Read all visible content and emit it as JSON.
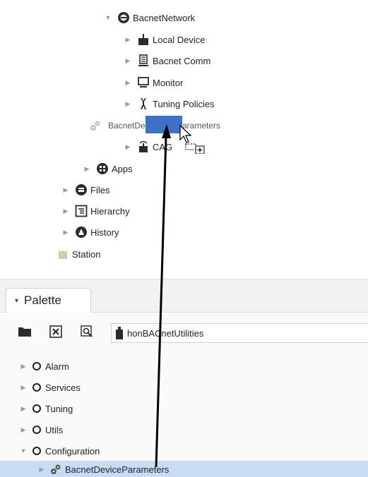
{
  "tree": {
    "items": [
      {
        "label": "BacnetNetwork",
        "icon": "network-globe-icon"
      },
      {
        "label": "Local Device",
        "icon": "device-icon"
      },
      {
        "label": "Bacnet Comm",
        "icon": "comm-stack-icon"
      },
      {
        "label": "Monitor",
        "icon": "monitor-icon"
      },
      {
        "label": "Tuning Policies",
        "icon": "tuning-tool-icon"
      },
      {
        "label": "BacnetDeviceParameters",
        "icon": "gears-icon"
      },
      {
        "label": "CAG",
        "icon": "device-antenna-icon"
      },
      {
        "label": "Apps",
        "icon": "apps-icon"
      },
      {
        "label": "Files",
        "icon": "files-icon"
      },
      {
        "label": "Hierarchy",
        "icon": "hierarchy-icon"
      },
      {
        "label": "History",
        "icon": "history-icon"
      },
      {
        "label": "Station",
        "icon": "station-icon"
      }
    ],
    "drag_overlay_text": "BacnetDe",
    "drag_overlay_text2": "arameters"
  },
  "palette": {
    "title": "Palette",
    "module": "honBACnetUtilities",
    "items": [
      {
        "label": "Alarm"
      },
      {
        "label": "Services"
      },
      {
        "label": "Tuning"
      },
      {
        "label": "Utils"
      },
      {
        "label": "Configuration"
      },
      {
        "label": "BacnetDeviceParameters"
      }
    ]
  },
  "colors": {
    "selection": "#3b72c7",
    "palette_selection": "#c9dcf5"
  }
}
